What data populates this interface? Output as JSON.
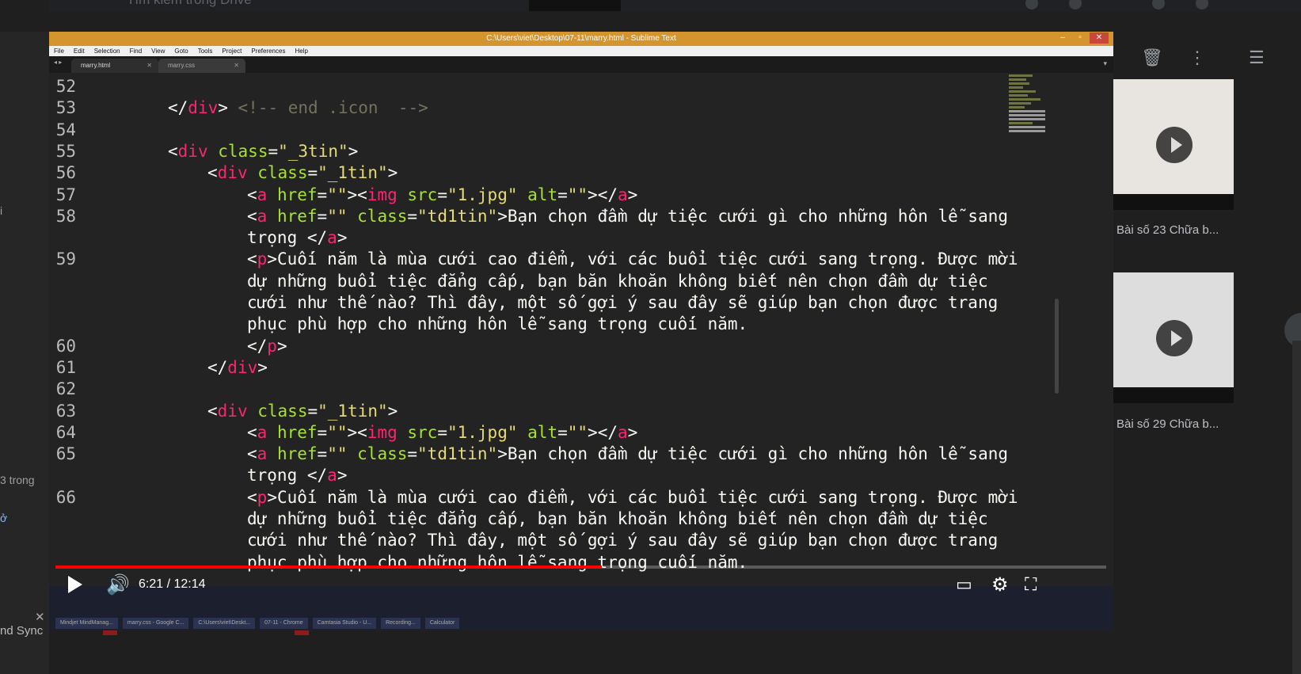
{
  "background": {
    "search_placeholder": "Tìm kiếm trong Drive",
    "left_snippets": [
      "i",
      "3 trong",
      "ở",
      "nd Sync"
    ],
    "thumbnails": [
      {
        "caption": "Bài số 23 Chữa b..."
      },
      {
        "caption": "Bài số 29 Chữa b..."
      }
    ]
  },
  "editor_window": {
    "title": "C:\\Users\\viet\\Desktop\\07-11\\marry.html - Sublime Text",
    "menu": [
      "File",
      "Edit",
      "Selection",
      "Find",
      "View",
      "Goto",
      "Tools",
      "Project",
      "Preferences",
      "Help"
    ],
    "tabs": [
      {
        "label": "marry.html",
        "active": true
      },
      {
        "label": "marry.css",
        "active": false
      }
    ],
    "lines": [
      {
        "n": "52",
        "indent": 0,
        "html": ""
      },
      {
        "n": "53",
        "indent": 1,
        "html": "<span class='pun'>&lt;/</span><span class='tag'>div</span><span class='pun'>&gt;</span> <span class='com'>&lt;!-- end .icon  --&gt;</span>"
      },
      {
        "n": "54",
        "indent": 0,
        "html": ""
      },
      {
        "n": "55",
        "indent": 1,
        "html": "<span class='pun'>&lt;</span><span class='tag'>div</span> <span class='att'>class</span><span class='pun'>=</span><span class='str'>\"_3tin\"</span><span class='pun'>&gt;</span>"
      },
      {
        "n": "56",
        "indent": 2,
        "html": "<span class='pun'>&lt;</span><span class='tag'>div</span> <span class='att'>class</span><span class='pun'>=</span><span class='str'>\"_1tin\"</span><span class='pun'>&gt;</span>"
      },
      {
        "n": "57",
        "indent": 3,
        "html": "<span class='pun'>&lt;</span><span class='tag'>a</span> <span class='att'>href</span><span class='pun'>=</span><span class='str'>\"\"</span><span class='pun'>&gt;&lt;</span><span class='tag'>img</span> <span class='att'>src</span><span class='pun'>=</span><span class='str'>\"1.jpg\"</span> <span class='att'>alt</span><span class='pun'>=</span><span class='str'>\"\"</span><span class='pun'>&gt;&lt;/</span><span class='tag'>a</span><span class='pun'>&gt;</span>"
      },
      {
        "n": "58",
        "indent": 3,
        "html": "<span class='pun'>&lt;</span><span class='tag'>a</span> <span class='att'>href</span><span class='pun'>=</span><span class='str'>\"\"</span> <span class='att'>class</span><span class='pun'>=</span><span class='str'>\"td1tin\"</span><span class='pun'>&gt;</span><span class='txt'>Bạn chọn đầm dự tiệc cưới gì cho những hôn lễ sang</span>"
      },
      {
        "n": "",
        "indent": 3,
        "html": "<span class='txt'>trọng </span><span class='pun'>&lt;/</span><span class='tag'>a</span><span class='pun'>&gt;</span>"
      },
      {
        "n": "59",
        "indent": 3,
        "html": "<span class='pun'>&lt;</span><span class='tag'>p</span><span class='pun'>&gt;</span><span class='txt'>Cuối năm là mùa cưới cao điểm, với các buổi tiệc cưới sang trọng. Được mời</span>"
      },
      {
        "n": "",
        "indent": 3,
        "html": "<span class='txt'>dự những buổi tiệc đẳng cấp, bạn băn khoăn không biết nên chọn đầm dự tiệc</span>"
      },
      {
        "n": "",
        "indent": 3,
        "html": "<span class='txt'>cưới như thế nào? Thì đây, một số gợi ý sau đây sẽ giúp bạn chọn được trang</span>"
      },
      {
        "n": "",
        "indent": 3,
        "html": "<span class='txt'>phục phù hợp cho những hôn lễ sang trọng cuối năm.</span>"
      },
      {
        "n": "60",
        "indent": 3,
        "html": "<span class='pun'>&lt;/</span><span class='tag'>p</span><span class='pun'>&gt;</span>"
      },
      {
        "n": "61",
        "indent": 2,
        "html": "<span class='pun'>&lt;/</span><span class='tag'>div</span><span class='pun'>&gt;</span>"
      },
      {
        "n": "62",
        "indent": 0,
        "html": ""
      },
      {
        "n": "63",
        "indent": 2,
        "html": "<span class='pun'>&lt;</span><span class='tag'>div</span> <span class='att'>class</span><span class='pun'>=</span><span class='str'>\"_1tin\"</span><span class='pun'>&gt;</span>"
      },
      {
        "n": "64",
        "indent": 3,
        "html": "<span class='pun'>&lt;</span><span class='tag'>a</span> <span class='att'>href</span><span class='pun'>=</span><span class='str'>\"\"</span><span class='pun'>&gt;&lt;</span><span class='tag'>img</span> <span class='att'>src</span><span class='pun'>=</span><span class='str'>\"1.jpg\"</span> <span class='att'>alt</span><span class='pun'>=</span><span class='str'>\"\"</span><span class='pun'>&gt;&lt;/</span><span class='tag'>a</span><span class='pun'>&gt;</span>"
      },
      {
        "n": "65",
        "indent": 3,
        "html": "<span class='pun'>&lt;</span><span class='tag'>a</span> <span class='att'>href</span><span class='pun'>=</span><span class='str'>\"\"</span> <span class='att'>class</span><span class='pun'>=</span><span class='str'>\"td1tin\"</span><span class='pun'>&gt;</span><span class='txt'>Bạn chọn đầm dự tiệc cưới gì cho những hôn lễ sang</span>"
      },
      {
        "n": "",
        "indent": 3,
        "html": "<span class='txt'>trọng </span><span class='pun'>&lt;/</span><span class='tag'>a</span><span class='pun'>&gt;</span>"
      },
      {
        "n": "66",
        "indent": 3,
        "html": "<span class='pun'>&lt;</span><span class='tag'>p</span><span class='pun'>&gt;</span><span class='txt'>Cuối năm là mùa cưới cao điểm, với các buổi tiệc cưới sang trọng. Được mời</span>"
      },
      {
        "n": "",
        "indent": 3,
        "html": "<span class='txt'>dự những buổi tiệc đẳng cấp, bạn băn khoăn không biết nên chọn đầm dự tiệc</span>"
      },
      {
        "n": "",
        "indent": 3,
        "html": "<span class='txt'>cưới như thế nào? Thì đây, một số gợi ý sau đây sẽ giúp bạn chọn được trang</span>"
      },
      {
        "n": "",
        "indent": 3,
        "html": "<span class='txt'>phục phù hợp cho những hôn lễ sang trọng cuối năm.</span>"
      }
    ],
    "taskbar_items": [
      "Mindjet MindManag...",
      "marry.css - Google C...",
      "C:\\Users\\viet\\Deskt...",
      "07-11 - Chrome",
      "Camtasia Studio - U...",
      "Recording...",
      "Calculator"
    ]
  },
  "player": {
    "time_current": "6:21",
    "time_total": "12:14",
    "time_display": "6:21 / 12:14",
    "progress": 0.52,
    "accent_color": "#ff0000"
  }
}
